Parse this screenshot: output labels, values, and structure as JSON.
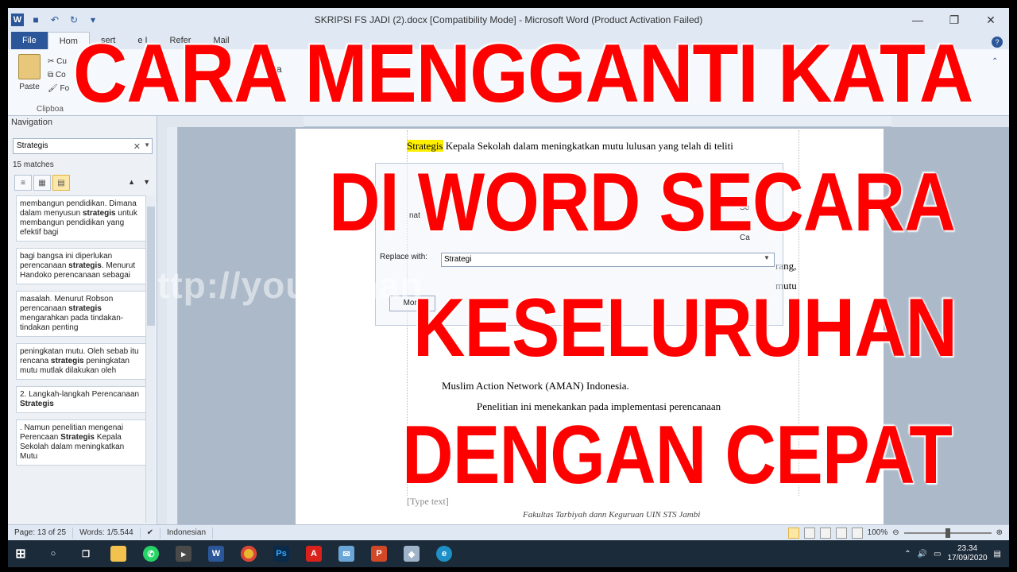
{
  "window": {
    "title": "SKRIPSI FS JADI (2).docx [Compatibility Mode]  -  Microsoft Word (Product Activation Failed)"
  },
  "ribbon": {
    "tabs": [
      "File",
      "Hom",
      "sert",
      "e I",
      "Refer",
      "Mail"
    ],
    "paste_label": "Paste",
    "clip_items": [
      "Cu",
      "Co",
      "Fo"
    ],
    "clipboard_label": "Clipboa",
    "font_case": "Aa"
  },
  "navigation": {
    "title": "Navigation",
    "search_value": "Strategis",
    "matches": "15 matches",
    "results": [
      {
        "before": "membangun pendidikan. Dimana dalam menyusun ",
        "match": "strategis",
        "after": " untuk membangun pendidikan yang efektif bagi"
      },
      {
        "before": "bagi bangsa ini diperlukan perencanaan ",
        "match": "strategis",
        "after": ". Menurut Handoko perencanaan sebagai"
      },
      {
        "before": "masalah. Menurut Robson perencanaan ",
        "match": "strategis",
        "after": " mengarahkan pada tindakan-tindakan penting"
      },
      {
        "before": "peningkatan mutu. Oleh sebab itu rencana ",
        "match": "strategis",
        "after": " peningkatan mutu mutlak dilakukan oleh"
      },
      {
        "before": "2. Langkah-langkah Perencanaan ",
        "match": "Strategis",
        "after": ""
      },
      {
        "before": ". Namun penelitian mengenai Perencaan ",
        "match": "Strategis",
        "after": " Kepala Sekolah dalam meningkatkan Mutu"
      }
    ]
  },
  "document": {
    "line1_highlight": "Strategis",
    "line1_rest": "  Kepala  Sekolah  dalam  meningkatkan  mutu  lulusan  yang  telah  di  teliti",
    "frag_orang": "rang,",
    "frag_mutu": "mutu",
    "line_aman": "Muslim  Action  Network  (AMAN)  Indonesia.",
    "line_penelitian": "Penelitian     ini     menekankan     pada     implementasi     perencanaan",
    "type_text": "[Type text]",
    "footer": "Fakultas Tarbiyah dann Keguruan UIN STS Jambi"
  },
  "dialog": {
    "replace_label": "Replace with:",
    "replace_value": "Strategi",
    "more_button": "More",
    "frag1": "nat",
    "frag2": "Se",
    "frag3": "Ca"
  },
  "watermark": "ttp://yout                      uhan",
  "overlay": {
    "line1": "CARA MENGGANTI KATA",
    "line2": "DI WORD SECARA",
    "line3": "KESELURUHAN",
    "line4": "DENGAN CEPAT"
  },
  "status": {
    "page": "Page: 13 of 25",
    "words": "Words: 1/5.544",
    "language": "Indonesian",
    "zoom": "100%"
  },
  "taskbar": {
    "time": "23.34",
    "date": "17/09/2020",
    "apps": [
      "start-icon",
      "search-icon",
      "task-view-icon",
      "file-explorer-icon",
      "whatsapp-icon",
      "sublime-icon",
      "word-icon",
      "chrome-icon",
      "photoshop-icon",
      "acrobat-icon",
      "mail-icon",
      "powerpoint-icon",
      "app-icon",
      "edge-icon"
    ]
  },
  "colors": {
    "overlay_text": "#ff0000",
    "highlight": "#ffef00",
    "word_blue": "#2b579a"
  }
}
